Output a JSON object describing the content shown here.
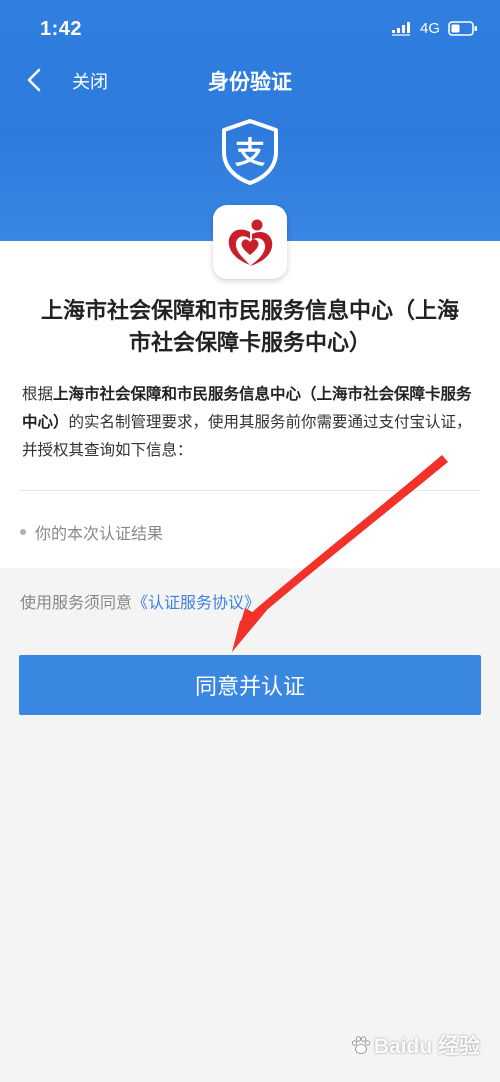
{
  "status_bar": {
    "time": "1:42",
    "network": "4G",
    "signal_icon": "signal-bars-icon",
    "battery_icon": "battery-icon"
  },
  "nav": {
    "back_icon": "chevron-left-icon",
    "close_label": "关闭",
    "title": "身份验证"
  },
  "header": {
    "shield_icon": "alipay-shield-icon",
    "shield_glyph": "支"
  },
  "service": {
    "logo_icon": "social-security-heart-logo",
    "title_line1": "上海市社会保障和市民服务信息中心（上海",
    "title_line2": "市社会保障卡服务中心）"
  },
  "description": {
    "prefix": "根据",
    "org_name": "上海市社会保障和市民服务信息中心（上海市社会保障卡服务中心）",
    "suffix": "的实名制管理要求，使用其服务前你需要通过支付宝认证，并授权其查询如下信息："
  },
  "info_items": [
    "你的本次认证结果"
  ],
  "agreement": {
    "prefix": "使用服务须同意",
    "link_label": "《认证服务协议》"
  },
  "primary_button": {
    "label": "同意并认证"
  },
  "watermark": {
    "text": "Baidu 经验"
  },
  "colors": {
    "header_blue": "#2f7fe0",
    "button_blue": "#3a87e2",
    "link_blue": "#3f82e0",
    "annotation_red": "#f2312b",
    "logo_red": "#c8202a"
  }
}
